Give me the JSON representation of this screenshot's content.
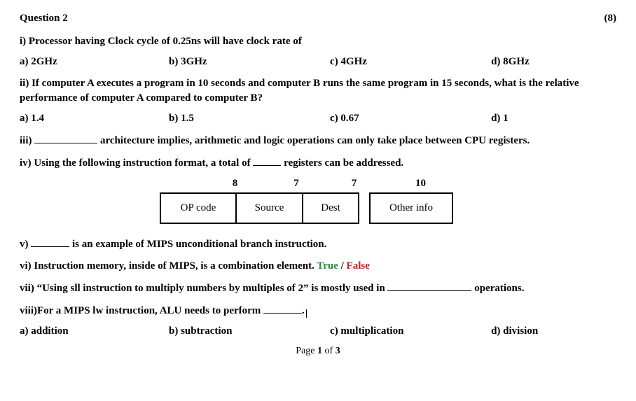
{
  "header": {
    "title": "Question 2",
    "marks": "(8)"
  },
  "q1": {
    "text": "i)   Processor having Clock cycle of 0.25ns will have clock rate of",
    "a": "a) 2GHz",
    "b": "b) 3GHz",
    "c": "c) 4GHz",
    "d": "d) 8GHz"
  },
  "q2": {
    "text": "ii)  If computer A executes a program in 10 seconds and computer B runs the same program in 15 seconds, what is the relative performance of computer A compared to computer B?",
    "a": "a) 1.4",
    "b": "b) 1.5",
    "c": "c) 0.67",
    "d": "d) 1"
  },
  "q3": {
    "prefix": "iii)",
    "rest": " architecture implies, arithmetic and logic operations can only take place between CPU registers."
  },
  "q4": {
    "prefix": "iv)  Using the following instruction format, a total of ",
    "suffix": " registers can be addressed."
  },
  "bits": {
    "b1": "8",
    "b2": "7",
    "b3": "7",
    "b4": "10"
  },
  "format": {
    "f1": "OP code",
    "f2": "Source",
    "f3": "Dest",
    "f4": "Other info"
  },
  "q5": {
    "prefix": "v)",
    "rest": " is an example of MIPS unconditional branch instruction."
  },
  "q6": {
    "prefix": "vi)  Instruction memory, inside of MIPS, is a combination element. ",
    "true": "True",
    "slash": " / ",
    "false": "False"
  },
  "q7": {
    "prefix": "vii) “Using sll instruction to multiply numbers by multiples of 2” is mostly used in ",
    "suffix": " operations."
  },
  "q8": {
    "prefix": "viii)For a MIPS lw instruction, ALU needs to perform ",
    "a": "a) addition",
    "b": "b) subtraction",
    "c": "c) multiplication",
    "d": "d) division"
  },
  "footer": {
    "page_prefix": "Page ",
    "page_num": "1",
    "page_suffix": " of ",
    "page_total": "3"
  },
  "chart_data": {
    "type": "table",
    "title": "Instruction format field widths (bits)",
    "columns": [
      "OP code",
      "Source",
      "Dest",
      "Other info"
    ],
    "bit_widths": [
      8,
      7,
      7,
      10
    ]
  }
}
